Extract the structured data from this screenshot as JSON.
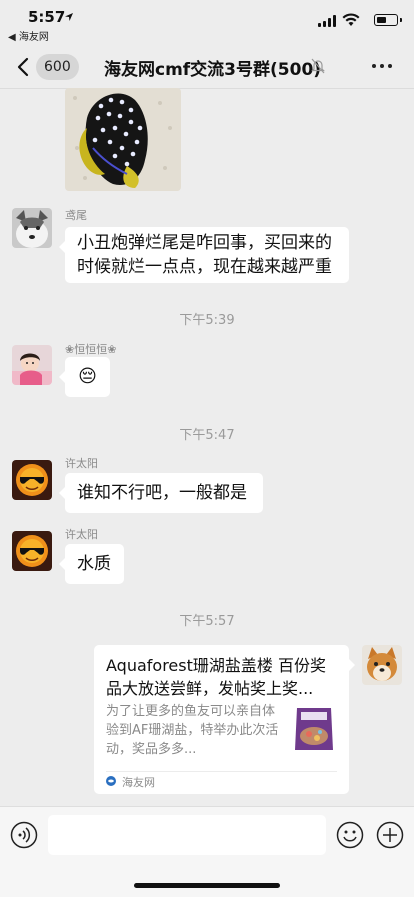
{
  "status": {
    "time": "5:57",
    "back_app": "◀ 海友网"
  },
  "nav": {
    "unread_count": "600",
    "title": "海友网cmf交流3号群(500)"
  },
  "messages": {
    "m1": {
      "sender": "鸢尾",
      "text": "小丑炮弹烂尾是咋回事，买回来的时候就烂一点点，现在越来越严重"
    },
    "t1": "下午5:39",
    "m2": {
      "sender": "❀恒恒恒❀",
      "emoji": "😔"
    },
    "t2": "下午5:47",
    "m3": {
      "sender": "许太阳",
      "text": "谁知不行吧，一般都是"
    },
    "m4": {
      "sender": "许太阳",
      "text": "水质"
    },
    "t3": "下午5:57",
    "card": {
      "title": "Aquaforest珊湖盐盖楼 百份奖品大放送尝鲜，发帖奖上奖...",
      "desc": "为了让更多的鱼友可以亲自体验到AF珊湖盐，特举办此次活动，奖品多多...",
      "source": "海友网"
    }
  },
  "colors": {
    "bg": "#ededed",
    "bubble": "#ffffff",
    "meta": "#9a9a9a"
  }
}
